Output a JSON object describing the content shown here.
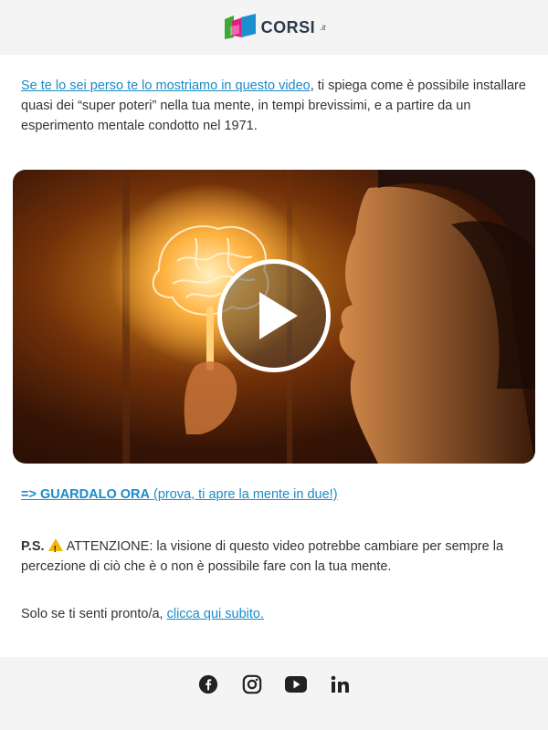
{
  "header": {
    "brand": "CORSI",
    "brand_suffix": ".it"
  },
  "intro": {
    "link_text": "Se te lo sei perso te lo mostriamo in questo video",
    "text": ", ti spiega come è possibile installare quasi dei “super poteri” nella tua mente, in tempi brevissimi, e a partire da un esperimento mentale condotto nel 1971."
  },
  "video": {
    "icon": "play-icon"
  },
  "cta": {
    "strong": "=> GUARDALO ORA",
    "rest": " (prova, ti apre la mente in due!)"
  },
  "ps": {
    "label": "P.S.",
    "icon": "warning-icon",
    "text": "ATTENZIONE: la visione di questo video potrebbe cambiare per sempre la percezione di ciò che è o non è possibile fare con la tua mente."
  },
  "final": {
    "text": "Solo se ti senti pronto/a, ",
    "link_text": "clicca qui subito."
  },
  "footer": {
    "icons": [
      "facebook-icon",
      "instagram-icon",
      "youtube-icon",
      "linkedin-icon"
    ]
  }
}
